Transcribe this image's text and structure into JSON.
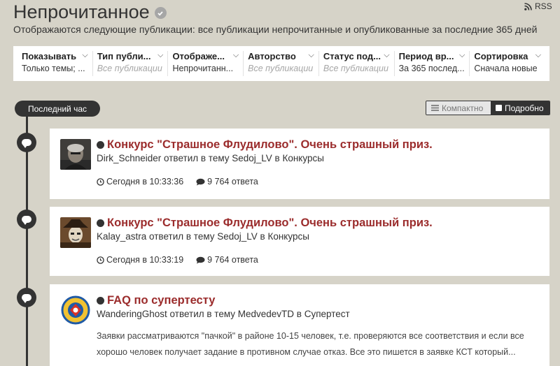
{
  "page": {
    "title": "Непрочитанное",
    "rss_label": "RSS",
    "subtitle": "Отображаются следующие публикации: все публикации непрочитанные и опубликованные за последние 365 дней"
  },
  "filters": [
    {
      "label": "Показывать",
      "value": "Только темы; ...",
      "muted": false
    },
    {
      "label": "Тип публи...",
      "value": "Все публикации",
      "muted": true
    },
    {
      "label": "Отображе...",
      "value": "Непрочитанн...",
      "muted": false
    },
    {
      "label": "Авторство",
      "value": "Все публикации",
      "muted": true
    },
    {
      "label": "Статус под...",
      "value": "Все публикации",
      "muted": true
    },
    {
      "label": "Период вр...",
      "value": "За 365 послед...",
      "muted": false
    },
    {
      "label": "Сортировка",
      "value": "Сначала новые",
      "muted": false
    }
  ],
  "timeline": {
    "label": "Последний час"
  },
  "view_toggle": {
    "compact": "Компактно",
    "detailed": "Подробно",
    "active": "detailed"
  },
  "posts": [
    {
      "title": "Конкурс \"Страшное Флудилово\". Очень страшный приз.",
      "meta": "Dirk_Schneider ответил в тему Sedoj_LV в Конкурсы",
      "time": "Сегодня в 10:33:36",
      "replies": "9 764 ответа",
      "avatar": "dark-portrait"
    },
    {
      "title": "Конкурс \"Страшное Флудилово\". Очень страшный приз.",
      "meta": "Kalay_astra ответил в тему Sedoj_LV в Конкурсы",
      "time": "Сегодня в 10:33:19",
      "replies": "9 764 ответа",
      "avatar": "hat-portrait"
    },
    {
      "title": "FAQ по супертесту",
      "meta": "WanderingGhost ответил в тему MedvedevTD в Супертест",
      "snippet": "Заявки рассматриваются \"пачкой\" в районе 10-15 человек, т.е. проверяются все соответствия и если все хорошо человек получает задание в противном случае отказ. Все это пишется в заявке КСТ который...",
      "avatar": "emblem"
    }
  ],
  "colors": {
    "background": "#d6d3c8",
    "title_red": "#9b2c2c",
    "dark": "#333333"
  }
}
